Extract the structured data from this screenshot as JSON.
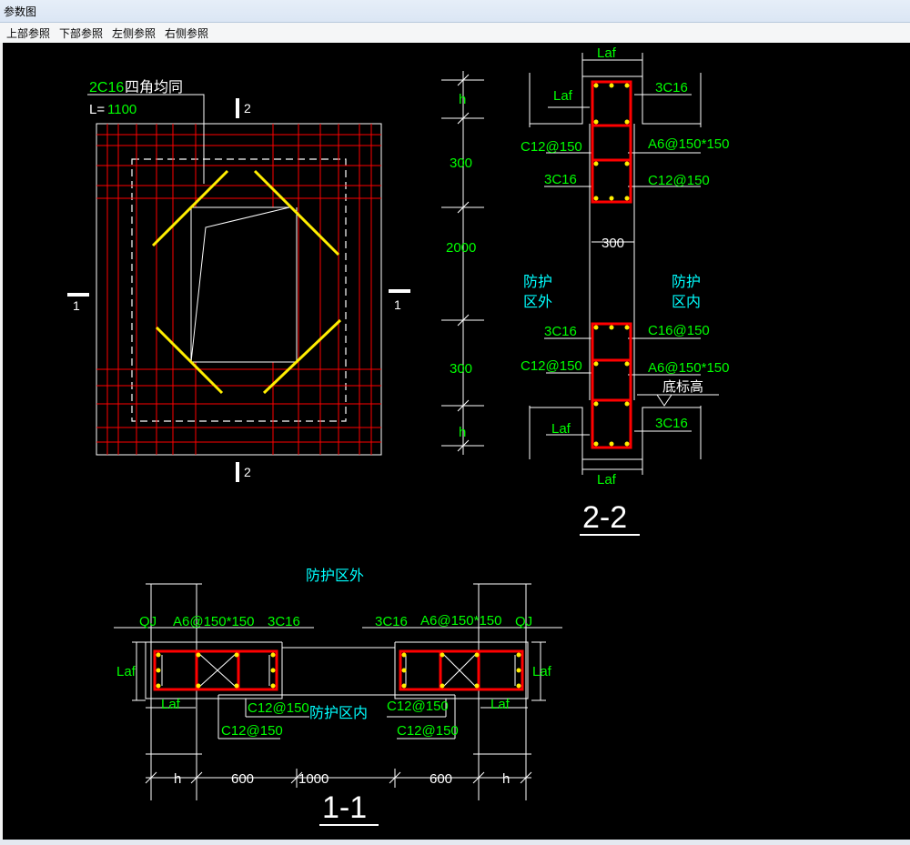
{
  "window": {
    "title": "参数图"
  },
  "menu": [
    {
      "label": "上部参照"
    },
    {
      "label": "下部参照"
    },
    {
      "label": "左侧参照"
    },
    {
      "label": "右侧参照"
    }
  ],
  "plan": {
    "bar_note_spec": "2C16",
    "bar_note_text": "四角均同",
    "length_prefix": "L=",
    "length_value": "1100",
    "cut_1": "1",
    "cut_2": "2"
  },
  "section_22": {
    "title": "2-2",
    "dims_left": [
      "h",
      "300",
      "2000",
      "300",
      "h"
    ],
    "laf": "Laf",
    "upper_right_top": "3C16",
    "upper_left_1": "C12@150",
    "upper_right_1": "A6@150*150",
    "upper_left_2": "3C16",
    "upper_right_2": "C12@150",
    "wall_thickness": "300",
    "zone_out": [
      "防护",
      "区外"
    ],
    "zone_in": [
      "防护",
      "区内"
    ],
    "lower_left_1": "3C16",
    "lower_right_1": "C16@150",
    "lower_left_2": "C12@150",
    "lower_right_2": "A6@150*150",
    "bottom_elevation": "底标高",
    "lower_right_bottom": "3C16"
  },
  "section_11": {
    "title": "1-1",
    "zone_out": "防护区外",
    "zone_in": "防护区内",
    "qj": "QJ",
    "laf": "Laf",
    "stirrup": "A6@150*150",
    "bar_3c16": "3C16",
    "c12": "C12@150",
    "dims_bottom": [
      "h",
      "600",
      "1000",
      "600",
      "h"
    ]
  },
  "colors": {
    "canvas_bg": "#000000",
    "rebar": "#ff0000",
    "diagonal_bar": "#ffee00",
    "label_green": "#00ff00",
    "label_cyan": "#00ffff",
    "line_white": "#ffffff"
  }
}
